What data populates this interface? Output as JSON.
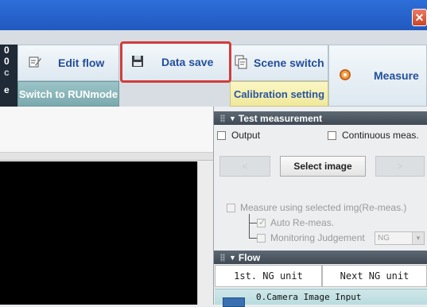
{
  "window": {
    "close_glyph": "✕"
  },
  "left_strip": {
    "lines": [
      "0",
      "0",
      "c",
      "e"
    ]
  },
  "toolbar": {
    "edit_flow": {
      "label": "Edit flow",
      "icon": "edit-flow-icon"
    },
    "data_save": {
      "label": "Data save",
      "icon": "floppy-disk-icon"
    },
    "scene_switch": {
      "label": "Scene switch",
      "icon": "scene-switch-icon"
    },
    "measure": {
      "label": "Measure",
      "icon": "measure-icon"
    },
    "switch_run": {
      "label": "Switch to RUNmode"
    },
    "calibration": {
      "label": "Calibration setting"
    }
  },
  "test_measurement": {
    "title": "Test measurement",
    "output_label": "Output",
    "continuous_label": "Continuous meas.",
    "prev_glyph": "<",
    "select_image": "Select image",
    "next_glyph": ">",
    "measure_selected_label": "Measure using selected img(Re-meas.)",
    "auto_remeas_label": "Auto Re-meas.",
    "monitoring_label": "Monitoring Judgement",
    "monitoring_value": "NG"
  },
  "flow": {
    "title": "Flow",
    "first_ng": "1st. NG unit",
    "next_ng": "Next NG unit",
    "first_item": "0.Camera Image Input"
  },
  "colors": {
    "titlebar": "#2159c0",
    "highlight": "#d23c3c",
    "teal": "#7aa9ad",
    "yellow": "#efe89c"
  }
}
